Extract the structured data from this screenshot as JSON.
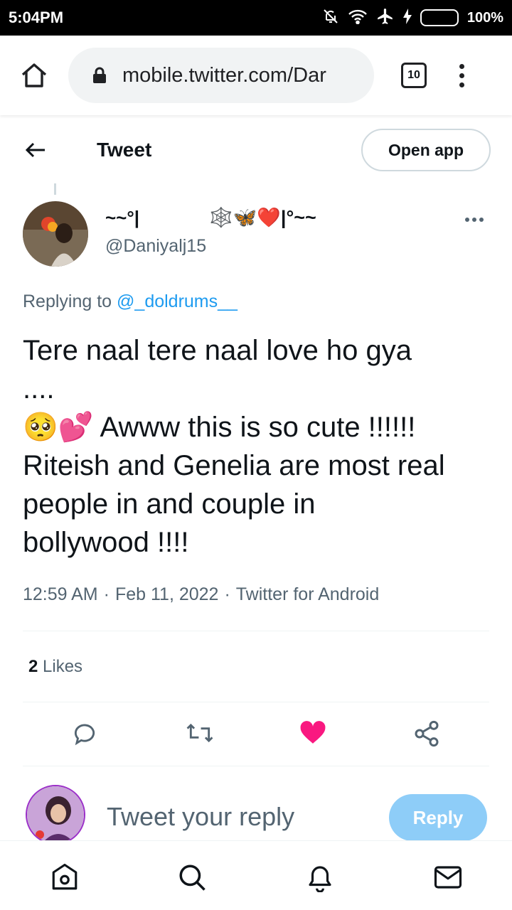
{
  "status_bar": {
    "time": "5:04PM",
    "battery": "100%"
  },
  "browser": {
    "url": "mobile.twitter.com/Dar",
    "tab_count": "10"
  },
  "header": {
    "title": "Tweet",
    "open_app_label": "Open app"
  },
  "tweet": {
    "display_name": "~~°|",
    "name_emoji": "🕸️🦋❤️|°~~",
    "handle": "@Daniyalj15",
    "replying_prefix": "Replying to",
    "replying_to": "@_doldrums__",
    "text_lines": [
      "Tere naal tere naal love ho gya",
      "....",
      "🥺💕 Awww this is so cute !!!!!!",
      "Riteish and Genelia are most real",
      "people in and couple in",
      "bollywood !!!!"
    ],
    "time": "12:59 AM",
    "date": "Feb 11, 2022",
    "source": "Twitter for Android",
    "likes_count": "2",
    "likes_label": "Likes"
  },
  "composer": {
    "placeholder": "Tweet your reply",
    "reply_label": "Reply"
  },
  "colors": {
    "accent": "#1d9bf0",
    "like": "#f91880",
    "reply_disabled": "#8ecdf8",
    "muted": "#536471"
  }
}
